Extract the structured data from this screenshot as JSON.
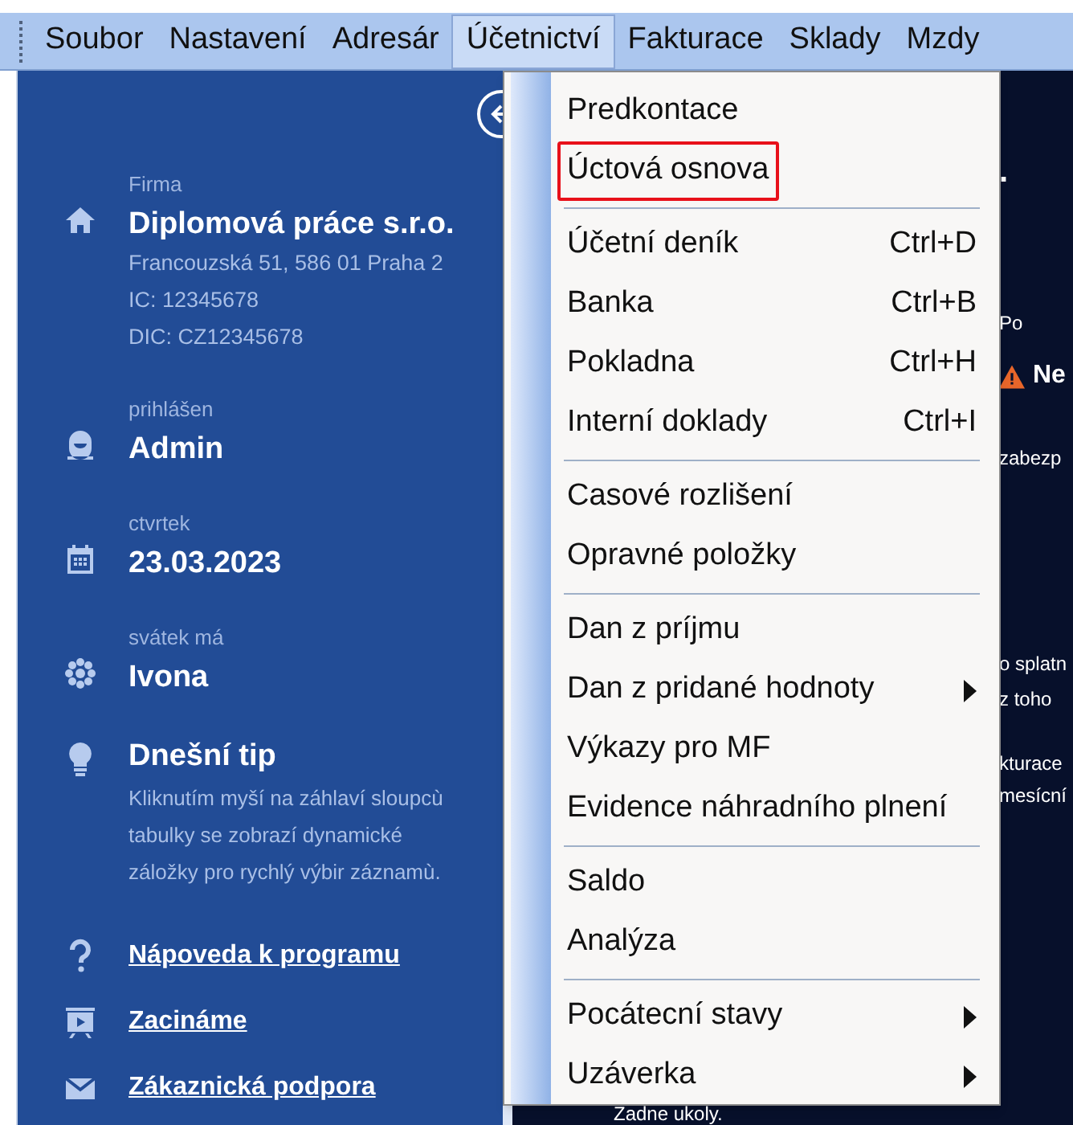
{
  "menubar": [
    {
      "label": "Soubor",
      "selected": false
    },
    {
      "label": "Nastavení",
      "selected": false
    },
    {
      "label": "Adresár",
      "selected": false
    },
    {
      "label": "Účetnictví",
      "selected": true
    },
    {
      "label": "Fakturace",
      "selected": false
    },
    {
      "label": "Sklady",
      "selected": false
    },
    {
      "label": "Mzdy",
      "selected": false
    }
  ],
  "sidebar": {
    "info": [
      {
        "kind": "company",
        "caption": "Firma",
        "title": "Diplomová práce s.r.o.",
        "lines": [
          "Francouzská 51, 586 01 Praha 2",
          "IC: 12345678",
          "DIC: CZ12345678"
        ]
      },
      {
        "kind": "user",
        "caption": "prihlášen",
        "title": "Admin"
      },
      {
        "kind": "calendar",
        "caption": "ctvrtek",
        "title": "23.03.2023"
      },
      {
        "kind": "flower",
        "caption": "svátek má",
        "title": "Ivona"
      },
      {
        "kind": "tip",
        "title": "Dnešní tip",
        "lines": [
          "Kliknutím myší na záhlaví sloupcù tabulky se zobrazí dynamické záložky pro rychlý výbir záznamù."
        ]
      }
    ],
    "links": [
      {
        "kind": "help",
        "label": "Nápoveda k programu"
      },
      {
        "kind": "video",
        "label": "Zacináme"
      },
      {
        "kind": "mail",
        "label": "Zákaznická podpora"
      }
    ]
  },
  "main_fragments": [
    {
      "kind": "plain",
      "text": "."
    },
    {
      "kind": "plain",
      "text": "Po"
    },
    {
      "kind": "warning",
      "text": "Ne"
    },
    {
      "kind": "plain",
      "text": "zabezp"
    },
    {
      "kind": "plain",
      "text": "o splatn"
    },
    {
      "kind": "plain",
      "text": "z toho"
    },
    {
      "kind": "plain",
      "text": "kturace"
    },
    {
      "kind": "plain",
      "text": "mesícní"
    }
  ],
  "footer_text": "Zadne ukoly.",
  "dropdown": [
    [
      {
        "label": "Predkontace",
        "highlighted": false
      },
      {
        "label": "Úctová osnova",
        "highlighted": true
      }
    ],
    [
      {
        "label": "Účetní deník",
        "shortcut": "Ctrl+D",
        "highlighted": false
      },
      {
        "label": "Banka",
        "shortcut": "Ctrl+B",
        "highlighted": false
      },
      {
        "label": "Pokladna",
        "shortcut": "Ctrl+H",
        "highlighted": false
      },
      {
        "label": "Interní doklady",
        "shortcut": "Ctrl+I",
        "highlighted": false
      }
    ],
    [
      {
        "label": "Casové rozlišení",
        "highlighted": false
      },
      {
        "label": "Opravné položky",
        "highlighted": false
      }
    ],
    [
      {
        "label": "Dan z príjmu",
        "highlighted": false
      },
      {
        "label": "Dan z pridané hodnoty",
        "submenu": true,
        "highlighted": false
      },
      {
        "label": "Výkazy pro MF",
        "highlighted": false
      },
      {
        "label": "Evidence náhradního plnení",
        "highlighted": false
      }
    ],
    [
      {
        "label": "Saldo",
        "highlighted": false
      },
      {
        "label": "Analýza",
        "highlighted": false
      }
    ],
    [
      {
        "label": "Pocátecní stavy",
        "submenu": true,
        "highlighted": false
      },
      {
        "label": "Uzáverka",
        "submenu": true,
        "highlighted": false
      }
    ]
  ]
}
